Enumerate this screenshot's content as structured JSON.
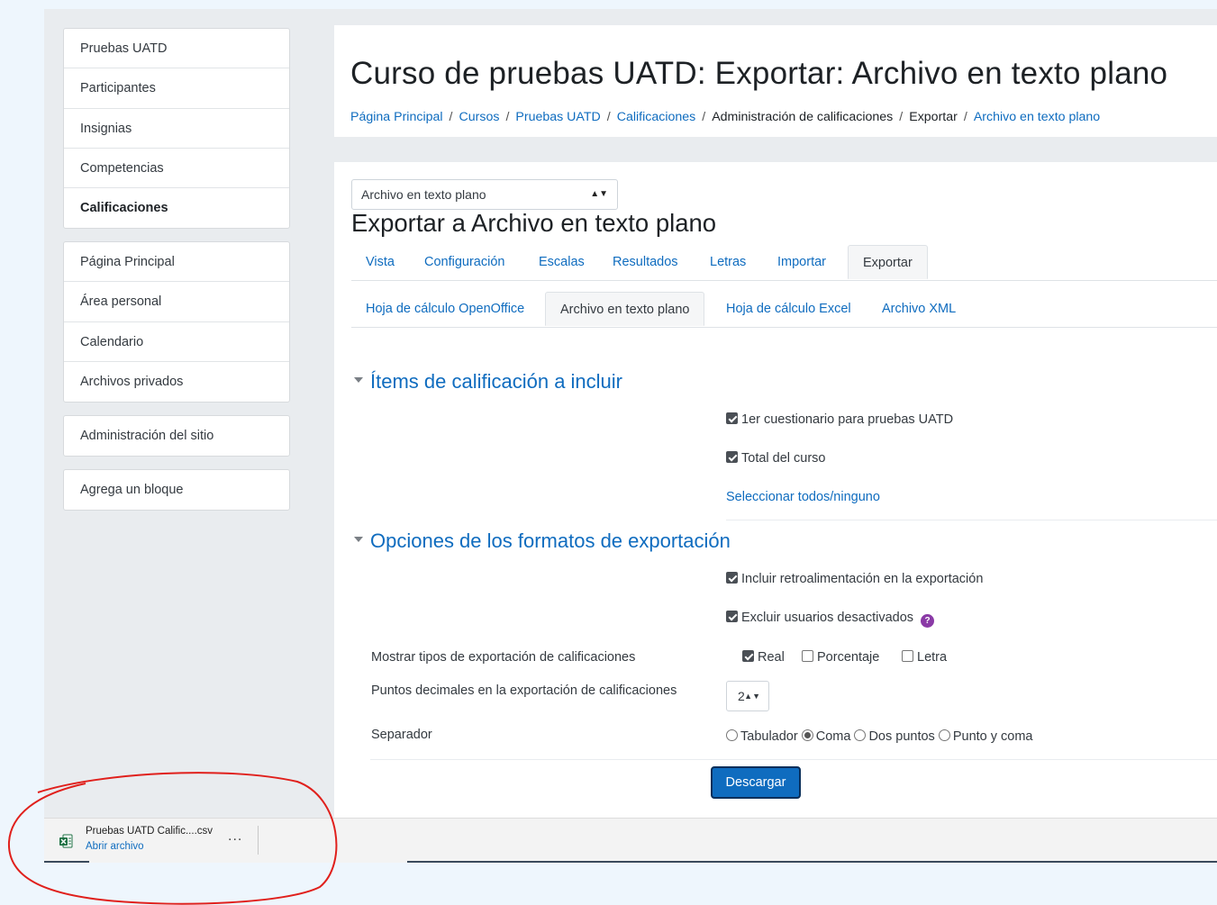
{
  "sidebar": {
    "course_block": [
      {
        "label": "Pruebas UATD",
        "active": false
      },
      {
        "label": "Participantes",
        "active": false
      },
      {
        "label": "Insignias",
        "active": false
      },
      {
        "label": "Competencias",
        "active": false
      },
      {
        "label": "Calificaciones",
        "active": true
      }
    ],
    "site_block": [
      {
        "label": "Página Principal"
      },
      {
        "label": "Área personal"
      },
      {
        "label": "Calendario"
      },
      {
        "label": "Archivos privados"
      }
    ],
    "admin_block": "Administración del sitio",
    "add_block": "Agrega un bloque"
  },
  "header": {
    "title": "Curso de pruebas UATD: Exportar: Archivo en texto plano",
    "breadcrumb": [
      {
        "label": "Página Principal",
        "link": true
      },
      {
        "label": "Cursos",
        "link": true
      },
      {
        "label": "Pruebas UATD",
        "link": true
      },
      {
        "label": "Calificaciones",
        "link": true
      },
      {
        "label": "Administración de calificaciones",
        "link": false
      },
      {
        "label": "Exportar",
        "link": false
      },
      {
        "label": "Archivo en texto plano",
        "link": true
      }
    ],
    "separator": "/"
  },
  "main": {
    "plugin_select": {
      "value": "Archivo en texto plano",
      "arrows": "▲▼"
    },
    "heading": "Exportar a Archivo en texto plano",
    "tabs": [
      {
        "label": "Vista",
        "active": false
      },
      {
        "label": "Configuración",
        "active": false
      },
      {
        "label": "Escalas",
        "active": false
      },
      {
        "label": "Resultados",
        "active": false
      },
      {
        "label": "Letras",
        "active": false
      },
      {
        "label": "Importar",
        "active": false
      },
      {
        "label": "Exportar",
        "active": true
      }
    ],
    "subtabs": [
      {
        "label": "Hoja de cálculo OpenOffice",
        "active": false
      },
      {
        "label": "Archivo en texto plano",
        "active": true
      },
      {
        "label": "Hoja de cálculo Excel",
        "active": false
      },
      {
        "label": "Archivo XML",
        "active": false
      }
    ],
    "items_section": {
      "legend": "Ítems de calificación a incluir",
      "items": [
        {
          "label": "1er cuestionario para pruebas UATD",
          "checked": true
        },
        {
          "label": "Total del curso",
          "checked": true
        }
      ],
      "select_all_link": "Seleccionar todos/ninguno"
    },
    "options_section": {
      "legend": "Opciones de los formatos de exportación",
      "include_feedback": {
        "label": "Incluir retroalimentación en la exportación",
        "checked": true
      },
      "exclude_suspended": {
        "label": "Excluir usuarios desactivados",
        "checked": true,
        "help_icon": "?"
      },
      "display_types": {
        "label": "Mostrar tipos de exportación de calificaciones",
        "options": [
          {
            "label": "Real",
            "checked": true
          },
          {
            "label": "Porcentaje",
            "checked": false
          },
          {
            "label": "Letra",
            "checked": false
          }
        ]
      },
      "decimal_points": {
        "label": "Puntos decimales en la exportación de calificaciones",
        "value": "2",
        "arrows": "▲▼"
      },
      "separator": {
        "label": "Separador",
        "options": [
          {
            "label": "Tabulador",
            "checked": false
          },
          {
            "label": "Coma",
            "checked": true
          },
          {
            "label": "Dos puntos",
            "checked": false
          },
          {
            "label": "Punto y coma",
            "checked": false
          }
        ]
      }
    },
    "download_button": "Descargar"
  },
  "download_bar": {
    "filename": "Pruebas UATD Calific....csv",
    "open_link": "Abrir archivo",
    "more_label": "...",
    "icon": "excel-file-icon"
  },
  "colors": {
    "link": "#0f6cbf",
    "button": "#0f6cbf",
    "annotation": "#e0201c",
    "page_bg": "#e9ecef"
  }
}
